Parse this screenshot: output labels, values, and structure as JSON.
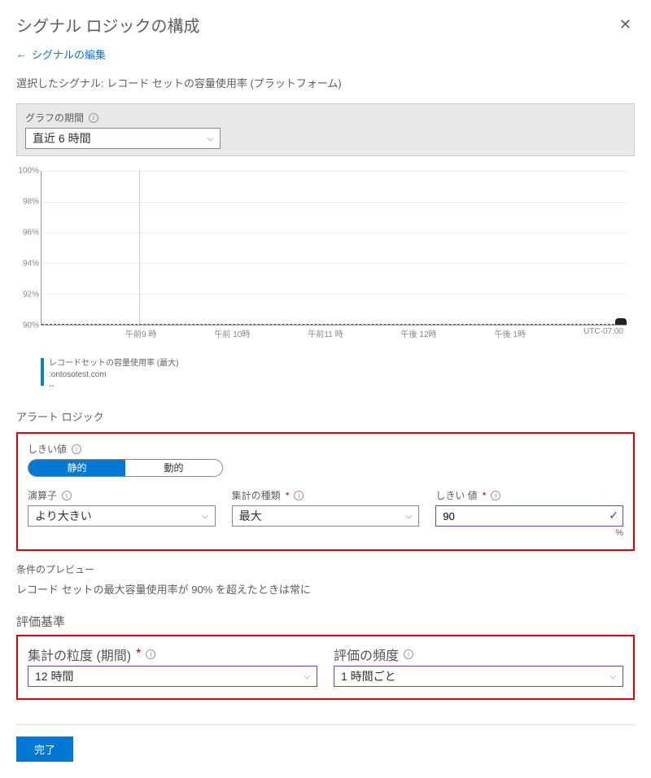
{
  "header": {
    "title": "シグナル ロジックの構成"
  },
  "back_link": "シグナルの編集",
  "selected_signal": "選択したシグナル: レコード セットの容量使用率 (プラットフォーム)",
  "graph_period": {
    "label": "グラフの期間",
    "value": "直近 6 時間"
  },
  "chart_data": {
    "type": "line",
    "title": "",
    "ylabel": "",
    "xlabel": "",
    "ylim": [
      90,
      100
    ],
    "y_ticks": [
      "100%",
      "98%",
      "96%",
      "94%",
      "92%",
      "90%"
    ],
    "x_ticks": [
      "午前9 時",
      "午前 10時",
      "午前11 時",
      "午後 12時",
      "午後 1時",
      "UTC-07:00"
    ],
    "threshold": 90,
    "series": [
      {
        "name": "レコードセットの容量使用率 (最大)",
        "values": []
      }
    ]
  },
  "legend": {
    "name": "レコードセットの容量使用率 (最大)",
    "resource": ":ontosotest.com",
    "value": "--"
  },
  "alert_logic": {
    "section": "アラート ロジック",
    "threshold_label": "しきい値",
    "toggle": {
      "static": "静的",
      "dynamic": "動的",
      "active": "static"
    },
    "operator": {
      "label": "演算子",
      "value": "より大きい"
    },
    "aggregation": {
      "label": "集計の種類",
      "value": "最大"
    },
    "threshold_value": {
      "label": "しきい 値",
      "value": "90",
      "unit": "%"
    }
  },
  "preview": {
    "label": "条件のプレビュー",
    "text": "レコード セットの最大容量使用率が 90% を超えたときは常に"
  },
  "evaluation": {
    "title": "評価基準",
    "granularity": {
      "label": "集計の粒度 (期間)",
      "value": "12 時間"
    },
    "frequency": {
      "label": "評価の頻度",
      "value": "1 時間ごと"
    }
  },
  "footer": {
    "done": "完了"
  }
}
